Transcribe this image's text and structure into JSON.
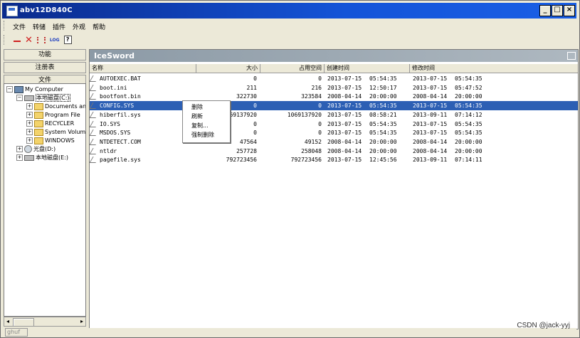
{
  "window": {
    "title": "abv12D840C",
    "buttons": [
      "_",
      "□",
      "×"
    ]
  },
  "menu": [
    "文件",
    "转储",
    "插件",
    "外观",
    "帮助"
  ],
  "toolbar_icons": [
    "minus-icon",
    "delete-x-icon",
    "grid-icon",
    "log-icon",
    "help-icon"
  ],
  "toolbar": {
    "log": "LOG",
    "help": "?"
  },
  "sidebar": {
    "buttons": [
      "功能",
      "注册表",
      "文件"
    ]
  },
  "tree": {
    "root": "My Computer",
    "drive_c": "本地磁盘(C:)",
    "folders": [
      "Documents an",
      "Program File",
      "RECYCLER",
      "System Volum",
      "WINDOWS"
    ],
    "drive_d": "光盘(D:)",
    "drive_e": "本地磁盘(E:)"
  },
  "panel": {
    "title": "IceSword"
  },
  "columns": [
    "名称",
    "大小",
    "占用空间",
    "创建时间",
    "修改时间"
  ],
  "files": [
    {
      "name": "AUTOEXEC.BAT",
      "size": "0",
      "alloc": "0",
      "c_date": "2013-07-15",
      "c_time": "05:54:35",
      "m_date": "2013-07-15",
      "m_time": "05:54:35"
    },
    {
      "name": "boot.ini",
      "size": "211",
      "alloc": "216",
      "c_date": "2013-07-15",
      "c_time": "12:50:17",
      "m_date": "2013-07-15",
      "m_time": "05:47:52"
    },
    {
      "name": "bootfont.bin",
      "size": "322730",
      "alloc": "323584",
      "c_date": "2008-04-14",
      "c_time": "20:00:00",
      "m_date": "2008-04-14",
      "m_time": "20:00:00"
    },
    {
      "name": "CONFIG.SYS",
      "size": "0",
      "alloc": "0",
      "c_date": "2013-07-15",
      "c_time": "05:54:35",
      "m_date": "2013-07-15",
      "m_time": "05:54:35",
      "selected": true
    },
    {
      "name": "hiberfil.sys",
      "size": "69137920",
      "alloc": "1069137920",
      "c_date": "2013-07-15",
      "c_time": "08:58:21",
      "m_date": "2013-09-11",
      "m_time": "07:14:12"
    },
    {
      "name": "IO.SYS",
      "size": "0",
      "alloc": "0",
      "c_date": "2013-07-15",
      "c_time": "05:54:35",
      "m_date": "2013-07-15",
      "m_time": "05:54:35"
    },
    {
      "name": "MSDOS.SYS",
      "size": "0",
      "alloc": "0",
      "c_date": "2013-07-15",
      "c_time": "05:54:35",
      "m_date": "2013-07-15",
      "m_time": "05:54:35"
    },
    {
      "name": "NTDETECT.COM",
      "size": "47564",
      "alloc": "49152",
      "c_date": "2008-04-14",
      "c_time": "20:00:00",
      "m_date": "2008-04-14",
      "m_time": "20:00:00"
    },
    {
      "name": "ntldr",
      "size": "257728",
      "alloc": "258048",
      "c_date": "2008-04-14",
      "c_time": "20:00:00",
      "m_date": "2008-04-14",
      "m_time": "20:00:00"
    },
    {
      "name": "pagefile.sys",
      "size": "792723456",
      "alloc": "792723456",
      "c_date": "2013-07-15",
      "c_time": "12:45:56",
      "m_date": "2013-09-11",
      "m_time": "07:14:11"
    }
  ],
  "context_menu": [
    "删除",
    "刷新",
    "复制...",
    "强制删除"
  ],
  "status": "ghuf",
  "watermark": "CSDN @jack-yyj"
}
